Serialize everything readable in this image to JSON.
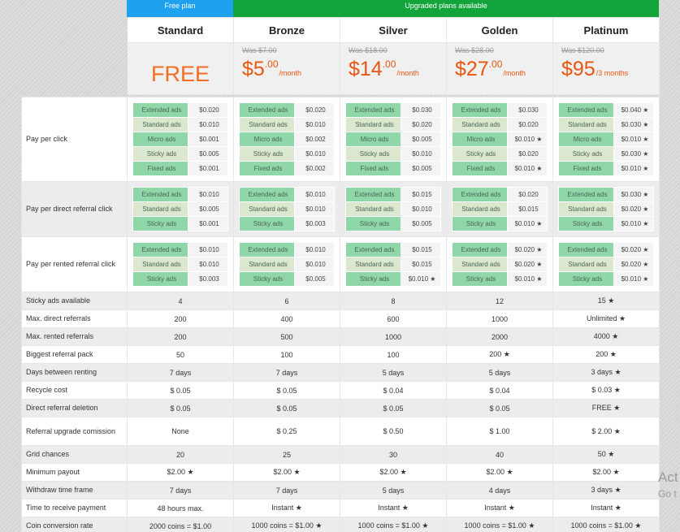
{
  "banners": {
    "free": "Free plan",
    "upgraded": "Upgraded plans available"
  },
  "plans": [
    {
      "name": "Standard",
      "was": "",
      "price_main": "",
      "price_cents": "",
      "period": "",
      "free_label": "FREE"
    },
    {
      "name": "Bronze",
      "was": "Was $7.00",
      "price_main": "$5",
      "price_cents": ".00",
      "period": "/month",
      "free_label": ""
    },
    {
      "name": "Silver",
      "was": "Was $18.00",
      "price_main": "$14",
      "price_cents": ".00",
      "period": "/month",
      "free_label": ""
    },
    {
      "name": "Golden",
      "was": "Was $28.00",
      "price_main": "$27",
      "price_cents": ".00",
      "period": "/month",
      "free_label": ""
    },
    {
      "name": "Platinum",
      "was": "Was $120.00",
      "price_main": "$95",
      "price_cents": "",
      "period": "/3 months",
      "free_label": ""
    }
  ],
  "ppc": {
    "label": "Pay per click",
    "keys": [
      "Extended ads",
      "Standard ads",
      "Micro ads",
      "Sticky ads",
      "Fixed ads"
    ],
    "values": [
      [
        "$0.020",
        "$0.010",
        "$0.001",
        "$0.005",
        "$0.001"
      ],
      [
        "$0.020",
        "$0.010",
        "$0.002",
        "$0.010",
        "$0.002"
      ],
      [
        "$0.030",
        "$0.020",
        "$0.005",
        "$0.010",
        "$0.005"
      ],
      [
        "$0.030",
        "$0.020",
        "$0.010 ★",
        "$0.020",
        "$0.010 ★"
      ],
      [
        "$0.040 ★",
        "$0.030 ★",
        "$0.010 ★",
        "$0.030 ★",
        "$0.010 ★"
      ]
    ]
  },
  "ppdr": {
    "label": "Pay per direct referral click",
    "keys": [
      "Extended ads",
      "Standard ads",
      "Sticky ads"
    ],
    "values": [
      [
        "$0.010",
        "$0.005",
        "$0.001"
      ],
      [
        "$0.010",
        "$0.010",
        "$0.003"
      ],
      [
        "$0.015",
        "$0.010",
        "$0.005"
      ],
      [
        "$0.020",
        "$0.015",
        "$0.010 ★"
      ],
      [
        "$0.030 ★",
        "$0.020 ★",
        "$0.010 ★"
      ]
    ]
  },
  "pprr": {
    "label": "Pay per rented referral click",
    "keys": [
      "Extended ads",
      "Standard ads",
      "Sticky ads"
    ],
    "values": [
      [
        "$0.010",
        "$0.010",
        "$0.003"
      ],
      [
        "$0.010",
        "$0.010",
        "$0.005"
      ],
      [
        "$0.015",
        "$0.015",
        "$0.010 ★"
      ],
      [
        "$0.020 ★",
        "$0.020 ★",
        "$0.010 ★"
      ],
      [
        "$0.020 ★",
        "$0.020 ★",
        "$0.010 ★"
      ]
    ]
  },
  "features": [
    {
      "label": "Sticky ads available",
      "values": [
        "4",
        "6",
        "8",
        "12",
        "15 ★"
      ]
    },
    {
      "label": "Max. direct referrals",
      "values": [
        "200",
        "400",
        "600",
        "1000",
        "Unlimited ★"
      ]
    },
    {
      "label": "Max. rented referrals",
      "values": [
        "200",
        "500",
        "1000",
        "2000",
        "4000 ★"
      ]
    },
    {
      "label": "Biggest referral pack",
      "values": [
        "50",
        "100",
        "100",
        "200 ★",
        "200 ★"
      ]
    },
    {
      "label": "Days between renting",
      "values": [
        "7 days",
        "7 days",
        "5 days",
        "5 days",
        "3 days ★"
      ]
    },
    {
      "label": "Recycle cost",
      "values": [
        "$ 0.05",
        "$ 0.05",
        "$ 0.04",
        "$ 0.04",
        "$ 0.03 ★"
      ]
    },
    {
      "label": "Direct referral deletion",
      "values": [
        "$ 0.05",
        "$ 0.05",
        "$ 0.05",
        "$ 0.05",
        "FREE ★"
      ]
    },
    {
      "label": "Referral upgrade comission",
      "values": [
        "None",
        "$ 0.25",
        "$ 0.50",
        "$ 1.00",
        "$ 2.00 ★"
      ]
    },
    {
      "label": "Grid chances",
      "values": [
        "20",
        "25",
        "30",
        "40",
        "50 ★"
      ]
    },
    {
      "label": "Minimum payout",
      "values": [
        "$2.00 ★",
        "$2.00 ★",
        "$2.00 ★",
        "$2.00 ★",
        "$2.00 ★"
      ]
    },
    {
      "label": "Withdraw time frame",
      "values": [
        "7 days",
        "7 days",
        "5 days",
        "4 days",
        "3 days ★"
      ]
    },
    {
      "label": "Time to receive payment",
      "values": [
        "48 hours max.",
        "Instant ★",
        "Instant ★",
        "Instant ★",
        "Instant ★"
      ]
    },
    {
      "label": "Coin conversion rate",
      "values": [
        "2000 coins = $1.00",
        "1000 coins = $1.00 ★",
        "1000 coins = $1.00 ★",
        "1000 coins = $1.00 ★",
        "1000 coins = $1.00 ★"
      ]
    }
  ],
  "watermark": {
    "line1": "Act",
    "line2": "Go t"
  }
}
